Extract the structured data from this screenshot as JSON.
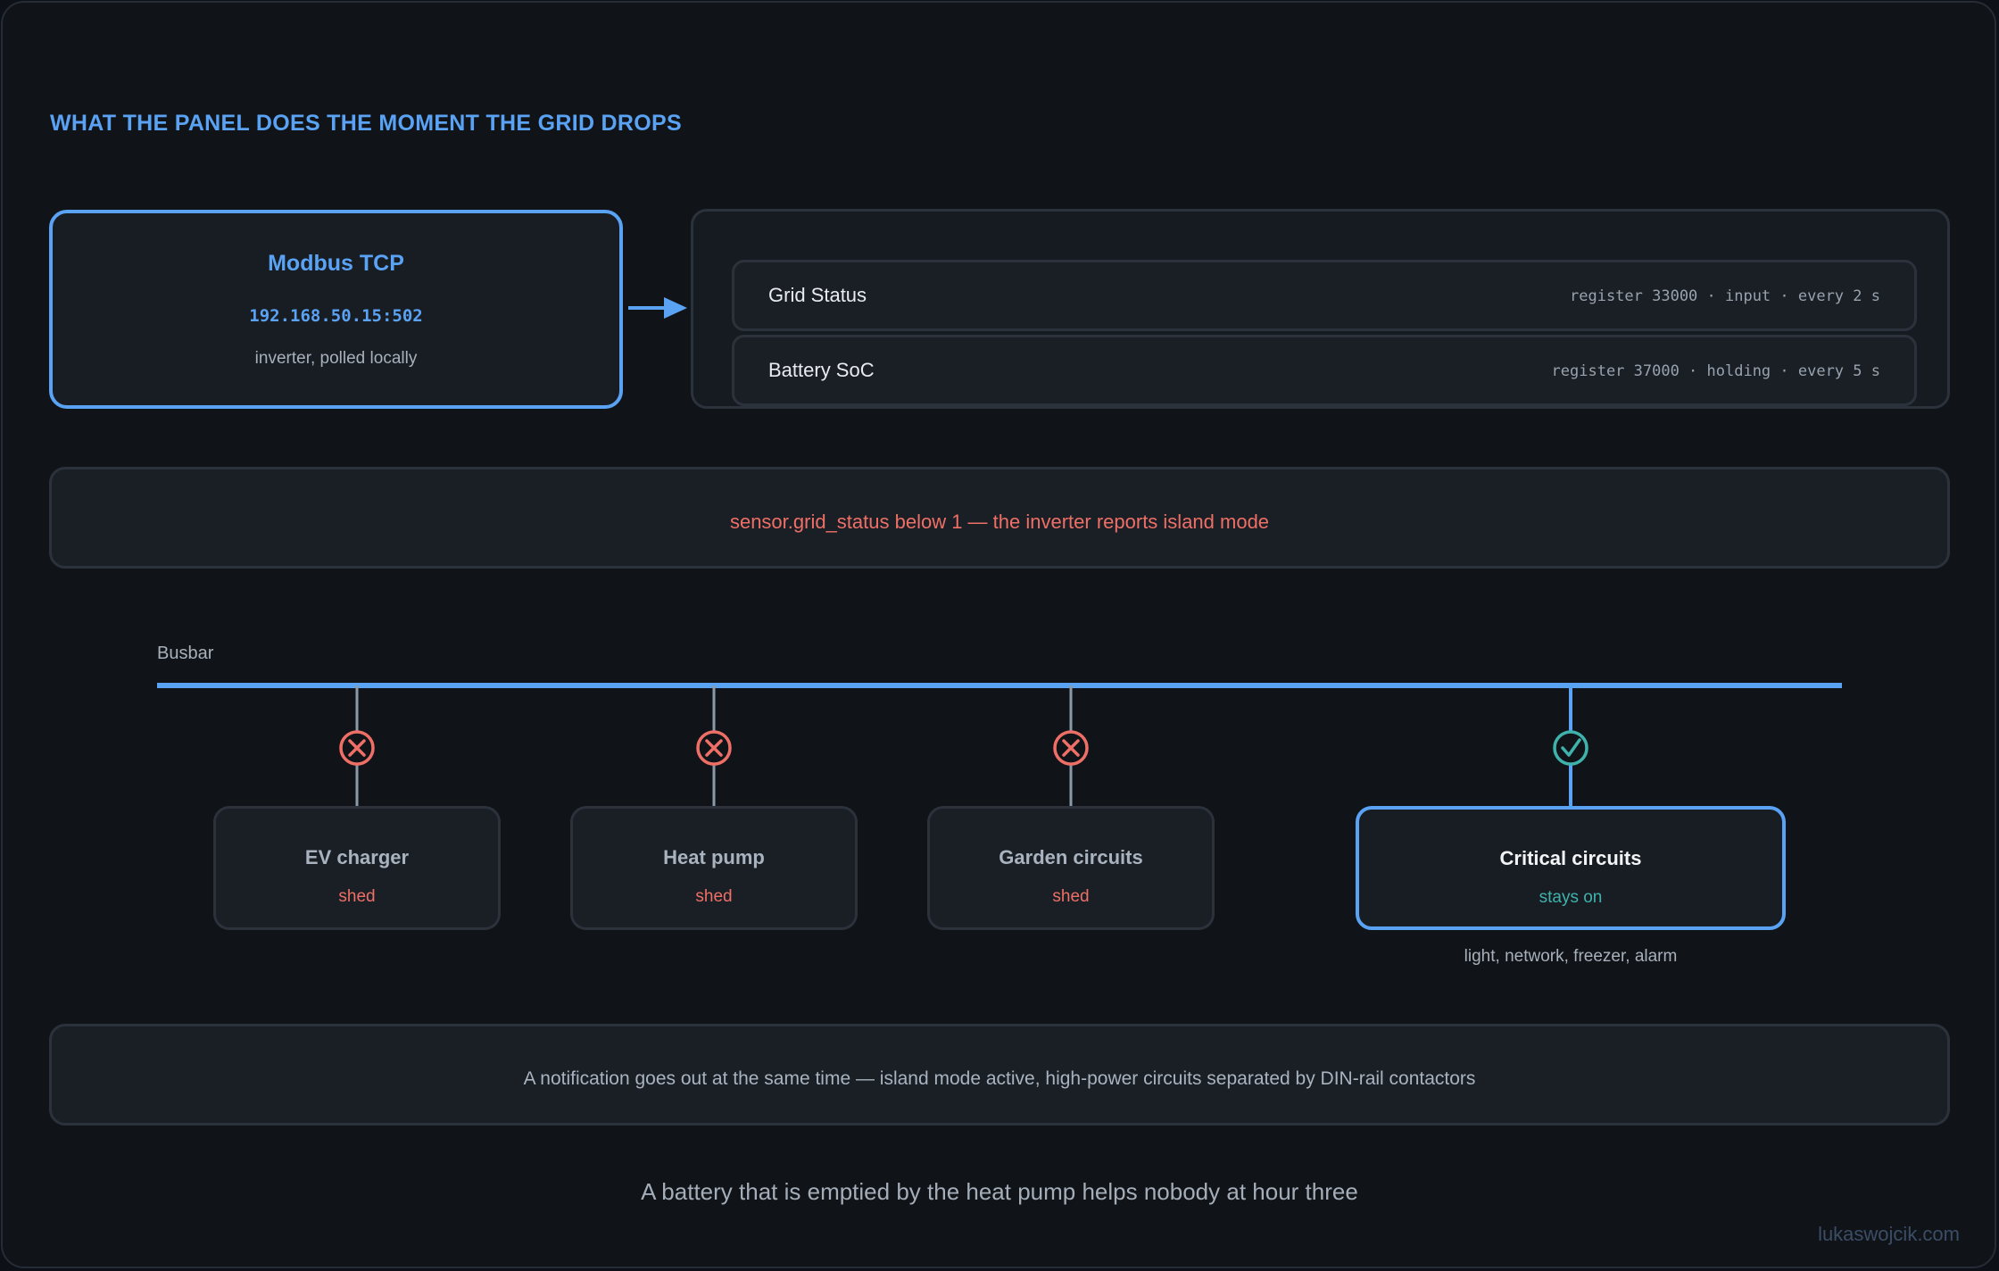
{
  "title": "WHAT THE PANEL DOES THE MOMENT THE GRID DROPS",
  "source": {
    "name": "Modbus TCP",
    "address": "192.168.50.15:502",
    "description": "inverter, polled locally"
  },
  "registers": [
    {
      "label": "Grid Status",
      "meta": "register 33000 · input · every 2 s"
    },
    {
      "label": "Battery SoC",
      "meta": "register 37000 · holding · every 5 s"
    }
  ],
  "trigger": "sensor.grid_status below 1 — the inverter reports island mode",
  "busbar_label": "Busbar",
  "circuits": [
    {
      "name": "EV charger",
      "state": "shed",
      "status": "off"
    },
    {
      "name": "Heat pump",
      "state": "shed",
      "status": "off"
    },
    {
      "name": "Garden circuits",
      "state": "shed",
      "status": "off"
    },
    {
      "name": "Critical circuits",
      "state": "stays on",
      "status": "on",
      "note": "light, network, freezer, alarm"
    }
  ],
  "notice": "A notification goes out at the same time — island mode active, high-power circuits separated by DIN-rail contactors",
  "footer": "A battery that is emptied by the heat pump helps nobody at hour three",
  "credit": "lukaswojcik.com",
  "colors": {
    "accent": "#5aa2f4",
    "shed": "#ee6f66",
    "on": "#3fb2ac",
    "background": "#101418",
    "card": "#1a1f25"
  }
}
